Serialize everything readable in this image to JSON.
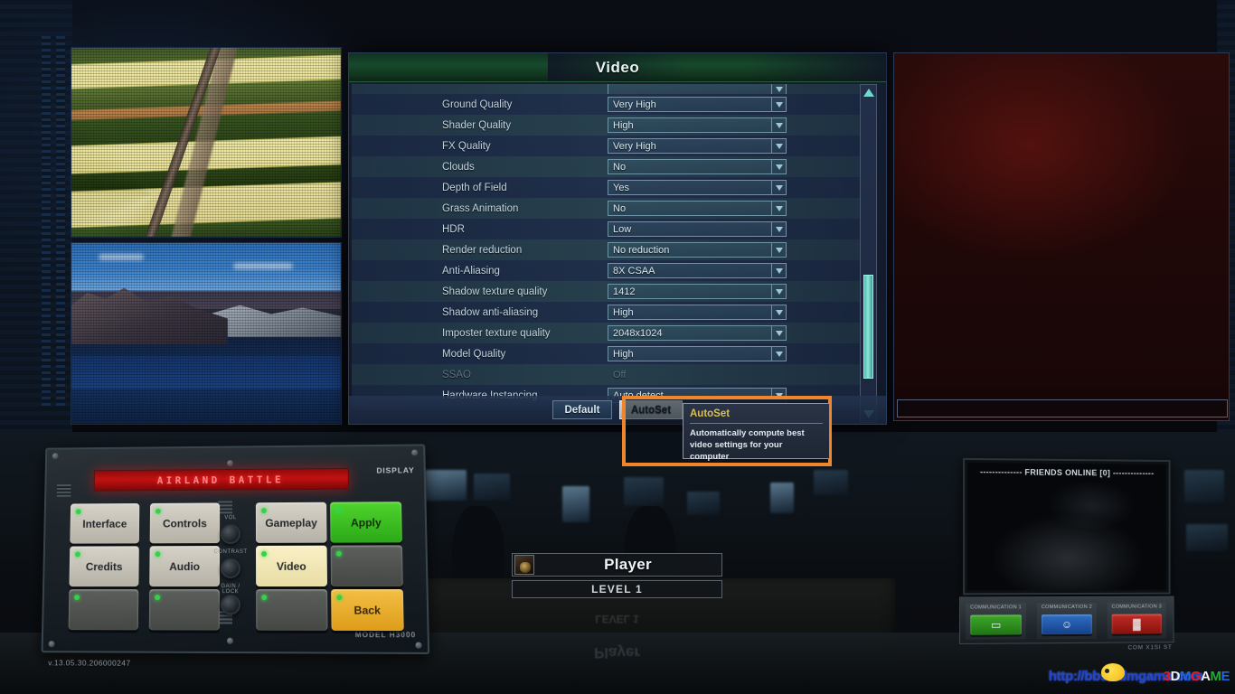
{
  "dialog": {
    "title": "Video",
    "settings": [
      {
        "label": "",
        "value": "",
        "clipped": true,
        "disabled": false
      },
      {
        "label": "Ground Quality",
        "value": "Very High",
        "disabled": false
      },
      {
        "label": "Shader Quality",
        "value": "High",
        "disabled": false
      },
      {
        "label": "FX Quality",
        "value": "Very High",
        "disabled": false
      },
      {
        "label": "Clouds",
        "value": "No",
        "disabled": false
      },
      {
        "label": "Depth of Field",
        "value": "Yes",
        "disabled": false
      },
      {
        "label": "Grass Animation",
        "value": "No",
        "disabled": false
      },
      {
        "label": "HDR",
        "value": "Low",
        "disabled": false
      },
      {
        "label": "Render reduction",
        "value": "No reduction",
        "disabled": false
      },
      {
        "label": "Anti-Aliasing",
        "value": "8X CSAA",
        "disabled": false
      },
      {
        "label": "Shadow texture quality",
        "value": "1412",
        "disabled": false
      },
      {
        "label": "Shadow anti-aliasing",
        "value": "High",
        "disabled": false
      },
      {
        "label": "Imposter texture quality",
        "value": "2048x1024",
        "disabled": false
      },
      {
        "label": "Model Quality",
        "value": "High",
        "disabled": false
      },
      {
        "label": "SSAO",
        "value": "Off",
        "disabled": true
      },
      {
        "label": "Hardware Instancing",
        "value": "Auto detect",
        "disabled": false
      }
    ],
    "footer": {
      "default_label": "Default",
      "autoset_label": "AutoSet"
    },
    "scrollbar": {
      "up_icon": "arrow-up-icon",
      "down_icon": "arrow-down-icon"
    }
  },
  "tooltip": {
    "title": "AutoSet",
    "body": "Automatically compute best video settings for your computer"
  },
  "console": {
    "led_text": "AIRLAND BATTLE",
    "display_label": "DISPLAY",
    "model_label": "MODEL H3000",
    "version": "v.13.05.30.206000247",
    "buttons": [
      {
        "label": "Interface",
        "state": "grey"
      },
      {
        "label": "Controls",
        "state": "grey"
      },
      {
        "label": "Gameplay",
        "state": "grey"
      },
      {
        "label": "Apply",
        "state": "green"
      },
      {
        "label": "Credits",
        "state": "grey"
      },
      {
        "label": "Audio",
        "state": "grey"
      },
      {
        "label": "Video",
        "state": "active"
      },
      {
        "label": "",
        "state": "empty"
      },
      {
        "label": "",
        "state": "empty"
      },
      {
        "label": "",
        "state": "empty"
      },
      {
        "label": "",
        "state": "empty"
      },
      {
        "label": "Back",
        "state": "amber"
      }
    ],
    "knob_labels": [
      "VOL",
      "CONTRAST",
      "GAIN / LOCK"
    ]
  },
  "player": {
    "name": "Player",
    "level": "LEVEL 1",
    "avatar_icon": "player-avatar-icon"
  },
  "friends": {
    "header": "-------------- FRIENDS ONLINE [0] --------------",
    "buttons": [
      {
        "slot_label": "COMMUNICATION 1",
        "icon": "chat-icon",
        "glyph": "▭",
        "color": "green"
      },
      {
        "slot_label": "COMMUNICATION 2",
        "icon": "add-friend-icon",
        "glyph": "☺",
        "color": "blue"
      },
      {
        "slot_label": "COMMUNICATION 3",
        "icon": "block-icon",
        "glyph": "▓",
        "color": "red"
      }
    ],
    "model_label": "COM X1SI ST"
  },
  "watermark": {
    "url": "http://bbs.3dmgame.com",
    "logo_parts": [
      "3",
      "D",
      "M",
      "G",
      "A",
      "M",
      "E"
    ]
  },
  "previews": {
    "top_alt": "aerial-farmland-preview",
    "bottom_alt": "mountain-lake-preview"
  },
  "colors": {
    "accent_orange": "#f0862c",
    "title_green": "#17492c",
    "apply_green": "#3cc423",
    "back_amber": "#e8a829",
    "scrollbar_teal": "#6fd9cd",
    "led_red": "#c21111",
    "tooltip_title": "#d8bf56"
  }
}
